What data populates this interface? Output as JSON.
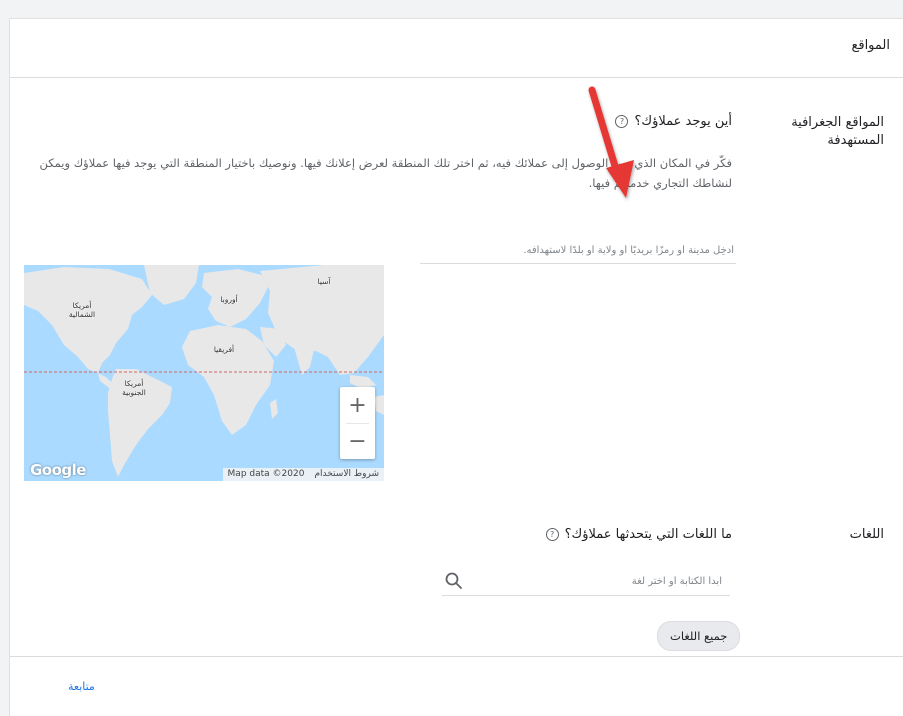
{
  "section": {
    "title": "المواقع"
  },
  "locations": {
    "label": "المواقع الجغرافية المستهدفة",
    "question": "أين يوجد عملاؤك؟",
    "description": "فكّر في المكان الذي تريد الوصول إلى عملائك فيه، ثم اختر تلك المنطقة لعرض إعلانك فيها. ونوصيك باختيار المنطقة التي يوجد فيها عملاؤك ويمكن لنشاطك التجاري خدمتهم فيها.",
    "input_placeholder": "أدخِل مدينة أو رمزًا بريديًا أو ولاية أو بلدًا لاستهدافه."
  },
  "map": {
    "labels": {
      "north_america": "أمريكا الشمالية",
      "south_america": "أمريكا الجنوبية",
      "europe": "أوروبا",
      "africa": "أفريقيا",
      "asia": "آسيا"
    },
    "zoom_in": "+",
    "zoom_out": "−",
    "logo": "Google",
    "map_data": "Map data ©2020",
    "terms": "شروط الاستخدام"
  },
  "languages": {
    "label": "اللغات",
    "question": "ما اللغات التي يتحدثها عملاؤك؟",
    "search_placeholder": "ابدأ الكتابة أو اختر لغة",
    "chip": "جميع اللغات"
  },
  "footer": {
    "continue": "متابعة"
  },
  "colors": {
    "link": "#1a73e8",
    "arrow": "#e53935",
    "water": "#aadaff",
    "land": "#e8e8e8"
  }
}
